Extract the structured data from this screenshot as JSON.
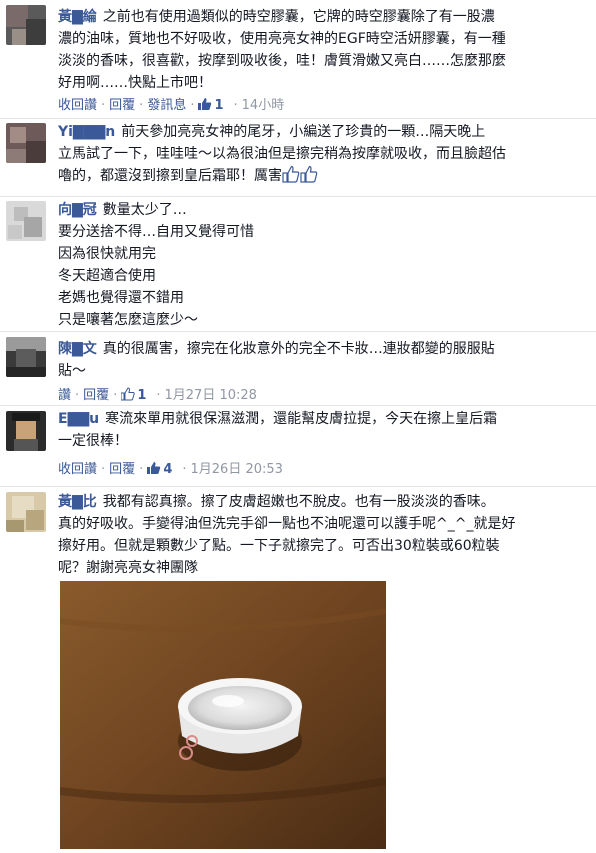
{
  "comments": [
    {
      "name": "黃▇綸",
      "lines": [
        "之前也有使用過類似的時空膠囊，它牌的時空膠囊除了有一股濃",
        "濃的油味，質地也不好吸收，使用亮亮女神的EGF時空活妍膠囊，有一種",
        "淡淡的香味，很喜歡，按摩到吸收後，哇！膚質滑嫩又亮白……怎麼那麼",
        "好用啊……快點上市吧！"
      ],
      "actions": [
        "收回讚",
        "回覆",
        "發訊息"
      ],
      "likes": "1",
      "time": "14小時"
    },
    {
      "name": "Yi▇▇▇n",
      "lines": [
        "前天參加亮亮女神的尾牙，小編送了珍貴的一顆…隔天晚上",
        "立馬試了一下，哇哇哇～以為很油但是擦完稍為按摩就吸收，而且臉超估",
        "嚕的，都還沒到擦到皇后霜耶！厲害"
      ],
      "actions": []
    },
    {
      "name": "向▇冠",
      "lines": [
        "數量太少了…",
        "要分送捨不得…自用又覺得可惜",
        "因為很快就用完",
        "冬天超適合使用",
        "老媽也覺得還不錯用",
        "只是嚷著怎麼這麼少～"
      ],
      "actions": []
    },
    {
      "name": "陳▇文",
      "lines": [
        "真的很厲害，擦完在化妝意外的完全不卡妝…連妝都變的服服貼",
        "貼～"
      ],
      "actions": [
        "讚",
        "回覆"
      ],
      "likes": "1",
      "time": "1月27日 10:28"
    },
    {
      "name": "E▇▇u",
      "lines": [
        "寒流來單用就很保濕滋潤，還能幫皮膚拉提，今天在擦上皇后霜",
        "一定很棒！"
      ],
      "actions": [
        "收回讚",
        "回覆"
      ],
      "likes": "4",
      "time": "1月26日 20:53"
    },
    {
      "name": "黃▇比",
      "lines": [
        "我都有認真擦。擦了皮膚超嫩也不脫皮。也有一股淡淡的香味。",
        "真的好吸收。手變得油但洗完手卻一點也不油呢還可以護手呢^_^_就是好",
        "擦好用。但就是顆數少了點。一下子就擦完了。可否出30粒裝或60粒裝",
        "呢？謝謝亮亮女神團隊"
      ],
      "actions": []
    }
  ]
}
